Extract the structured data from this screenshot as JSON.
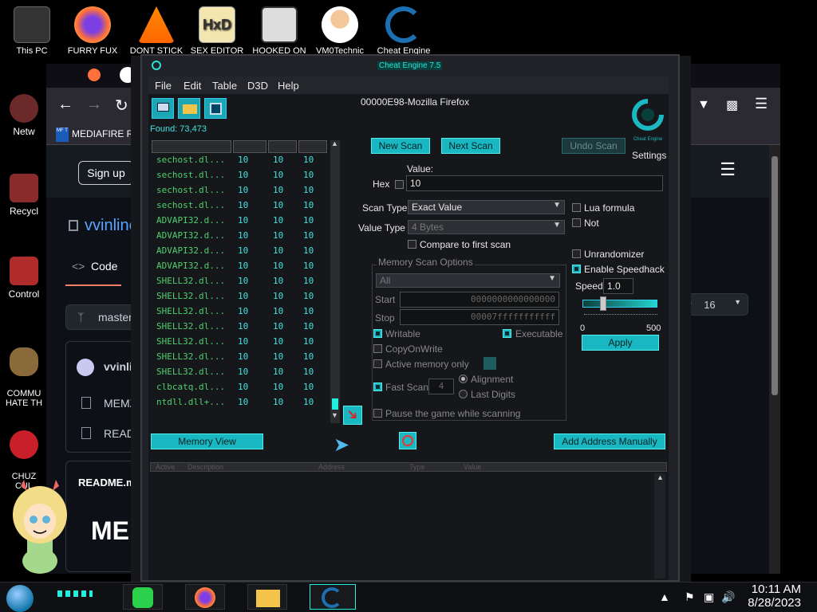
{
  "desktop": {
    "top_icons": [
      "This PC",
      "FURRY FUX",
      "DONT STICK",
      "SEX EDITOR",
      "HOOKED ON",
      "VM0Technic",
      "Cheat Engine"
    ],
    "left_icons": [
      "Netw",
      "Recycl",
      "Control",
      "COMMU\nHATE TH",
      "CHUZ\nCUL"
    ]
  },
  "firefox": {
    "bookmark": "MEDIAFIRE ROU",
    "bookmark_badge": "MF T",
    "signup": "Sign up",
    "repo": "vvinlinc",
    "code_tab": "Code",
    "branch": "master",
    "user": "vvinlir",
    "files": [
      "MEMZ",
      "READM"
    ],
    "readme": "README.m",
    "heading": "MEN",
    "star_count": "16",
    "star_prefix": "ar"
  },
  "ce": {
    "window_title": "Cheat Engine 7.5",
    "menu": [
      "File",
      "Edit",
      "Table",
      "D3D",
      "Help"
    ],
    "process": "00000E98-Mozilla Firefox",
    "found": "Found: 73,473",
    "results": [
      [
        "sechost.dl...",
        "10",
        "10",
        "10"
      ],
      [
        "sechost.dl...",
        "10",
        "10",
        "10"
      ],
      [
        "sechost.dl...",
        "10",
        "10",
        "10"
      ],
      [
        "sechost.dl...",
        "10",
        "10",
        "10"
      ],
      [
        "ADVAPI32.d...",
        "10",
        "10",
        "10"
      ],
      [
        "ADVAPI32.d...",
        "10",
        "10",
        "10"
      ],
      [
        "ADVAPI32.d...",
        "10",
        "10",
        "10"
      ],
      [
        "ADVAPI32.d...",
        "10",
        "10",
        "10"
      ],
      [
        "SHELL32.dl...",
        "10",
        "10",
        "10"
      ],
      [
        "SHELL32.dl...",
        "10",
        "10",
        "10"
      ],
      [
        "SHELL32.dl...",
        "10",
        "10",
        "10"
      ],
      [
        "SHELL32.dl...",
        "10",
        "10",
        "10"
      ],
      [
        "SHELL32.dl...",
        "10",
        "10",
        "10"
      ],
      [
        "SHELL32.dl...",
        "10",
        "10",
        "10"
      ],
      [
        "SHELL32.dl...",
        "10",
        "10",
        "10"
      ],
      [
        "clbcatq.dl...",
        "10",
        "10",
        "10"
      ],
      [
        "ntdll.dll+...",
        "10",
        "10",
        "10"
      ]
    ],
    "buttons": {
      "new_scan": "New Scan",
      "next_scan": "Next Scan",
      "undo_scan": "Undo Scan",
      "memory_view": "Memory View",
      "add_address": "Add Address Manually",
      "apply": "Apply"
    },
    "value_label": "Value:",
    "hex_label": "Hex",
    "value": "10",
    "scan_type_label": "Scan Type",
    "scan_type": "Exact Value",
    "value_type_label": "Value Type",
    "value_type": "4 Bytes",
    "compare_first": "Compare to first scan",
    "lua_formula": "Lua formula",
    "not_label": "Not",
    "unrandomizer": "Unrandomizer",
    "enable_speedhack": "Enable Speedhack",
    "speed_label": "Speed",
    "speed_value": "1.0",
    "speed_min": "0",
    "speed_max": "500",
    "settings": "Settings",
    "logo_text": "Cheat Engine",
    "mem_options": {
      "title": "Memory Scan Options",
      "region": "All",
      "start_label": "Start",
      "start": "0000000000000000",
      "stop_label": "Stop",
      "stop": "00007fffffffffff",
      "writable": "Writable",
      "executable": "Executable",
      "copy_on_write": "CopyOnWrite",
      "active_memory": "Active memory only",
      "fast_scan": "Fast Scan",
      "fast_scan_value": "4",
      "alignment": "Alignment",
      "last_digits": "Last Digits",
      "pause_game": "Pause the game while scanning"
    },
    "table_headers": [
      "Active",
      "Description",
      "Address",
      "Type",
      "Value"
    ]
  },
  "taskbar": {
    "time": "10:11 AM",
    "date": "8/28/2023"
  }
}
